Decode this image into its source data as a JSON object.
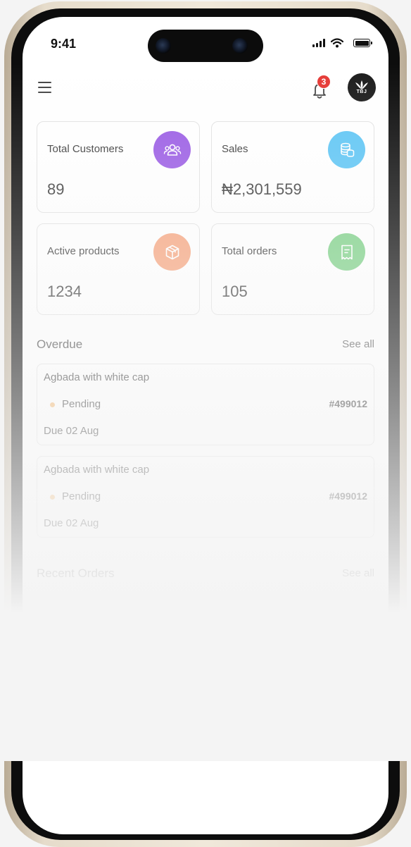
{
  "status_bar": {
    "time": "9:41"
  },
  "header": {
    "notification_count": "3",
    "avatar_logo_text": "TBJ"
  },
  "stats": [
    {
      "label": "Total Customers",
      "value": "89",
      "icon": "users-icon",
      "color": "#9b5de5"
    },
    {
      "label": "Sales",
      "value": "₦2,301,559",
      "icon": "coins-icon",
      "color": "#5fc6f5"
    },
    {
      "label": "Active products",
      "value": "1234",
      "icon": "box-icon",
      "color": "#f7a57f"
    },
    {
      "label": "Total orders",
      "value": "105",
      "icon": "receipt-icon",
      "color": "#7ed188"
    }
  ],
  "overdue": {
    "title": "Overdue",
    "see_all": "See all",
    "items": [
      {
        "name": "Agbada with white cap",
        "status": "Pending",
        "order_number": "#499012",
        "due": "Due 02 Aug"
      },
      {
        "name": "Agbada with white cap",
        "status": "Pending",
        "order_number": "#499012",
        "due": "Due 02 Aug"
      }
    ]
  },
  "recent_orders": {
    "title": "Recent Orders",
    "see_all": "See all"
  },
  "colors": {
    "badge": "#e53935",
    "pending_dot": "#f5b971"
  }
}
